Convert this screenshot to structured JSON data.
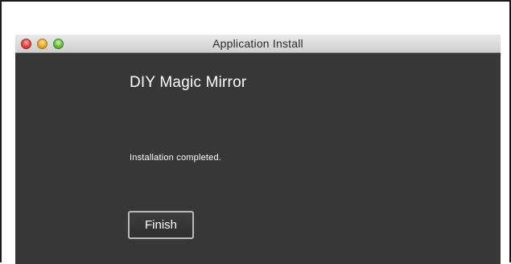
{
  "window": {
    "title": "Application Install"
  },
  "content": {
    "app_name": "DIY Magic Mirror",
    "status": "Installation completed.",
    "finish_label": "Finish"
  }
}
